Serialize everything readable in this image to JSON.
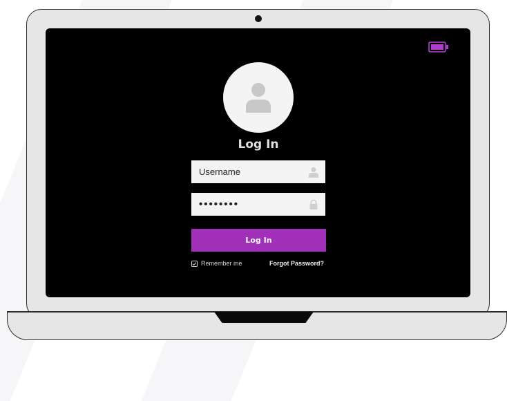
{
  "login": {
    "title": "Log In",
    "username_placeholder": "Username",
    "password_masked": "••••••••",
    "submit_label": "Log In",
    "remember_label": "Remember me",
    "remember_checked": true,
    "forgot_label": "Forgot Password?"
  },
  "icons": {
    "avatar": "user-icon",
    "username": "user-icon",
    "password": "lock-icon",
    "battery": "battery-icon"
  },
  "colors": {
    "accent": "#a030b8",
    "battery": "#b23bd0",
    "screen": "#000000",
    "field_bg": "#f4f4f4",
    "laptop_body": "#e6e6e6"
  }
}
